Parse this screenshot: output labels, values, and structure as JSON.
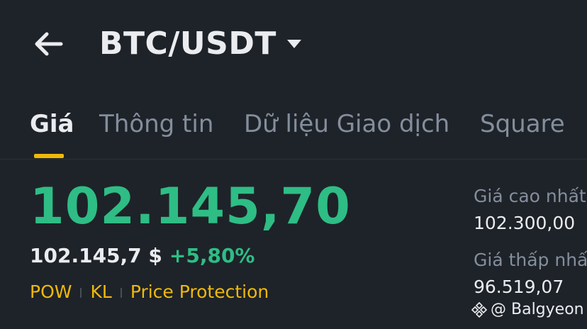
{
  "header": {
    "pair": "BTC/USDT",
    "back_icon": "arrow-left-icon",
    "dropdown_icon": "caret-down-icon"
  },
  "tabs": [
    {
      "label": "Giá",
      "active": true
    },
    {
      "label": "Thông tin",
      "active": false
    },
    {
      "label": "Dữ liệu Giao dịch",
      "active": false
    },
    {
      "label": "Square",
      "active": false
    }
  ],
  "colors": {
    "background": "#1e2329",
    "positive": "#2ebd85",
    "accent": "#f0b90b",
    "muted": "#848e9c"
  },
  "price": {
    "last": "102.145,70",
    "usd": "102.145,7 $",
    "change": "+5,80%"
  },
  "tags": [
    "POW",
    "KL",
    "Price Protection"
  ],
  "stats": {
    "high_label": "Giá cao nhất",
    "high_value": "102.300,00",
    "low_label": "Giá thấp nhất",
    "low_value": "96.519,07"
  },
  "watermark": {
    "text": "@ Balgyeon",
    "icon": "binance-logo-icon"
  }
}
